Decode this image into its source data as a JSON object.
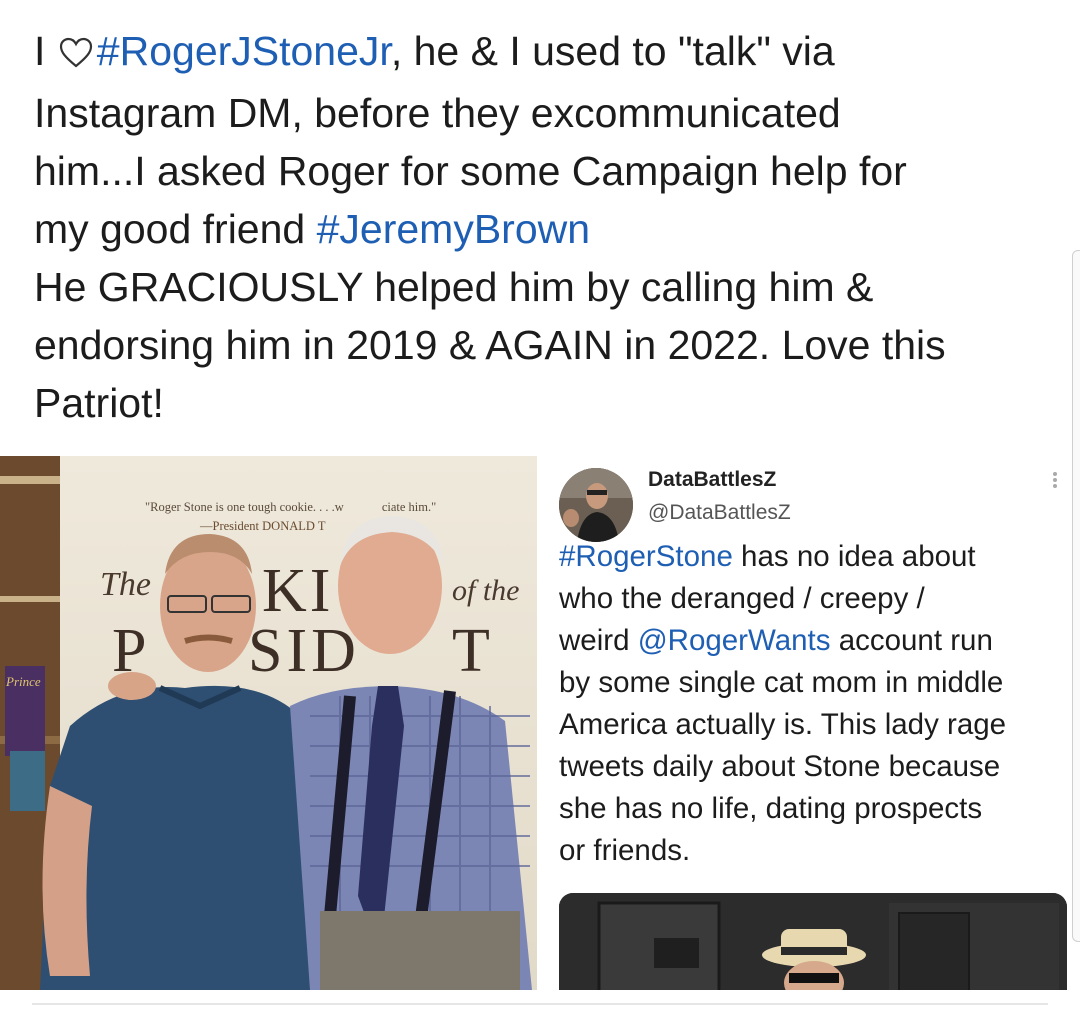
{
  "post": {
    "lines": [
      {
        "pre": "I ",
        "tag": "#RogerJStoneJr",
        "post": ", he & I used to \"talk\" via"
      },
      {
        "pre": "Instagram DM, before they excommunicated",
        "tag": "",
        "post": ""
      },
      {
        "pre": "him...I asked Roger for some Campaign help for",
        "tag": "",
        "post": ""
      },
      {
        "pre": "my good friend ",
        "tag": "#JeremyBrown",
        "post": ""
      },
      {
        "pre": "He GRACIOUSLY helped him by calling him &",
        "tag": "",
        "post": ""
      },
      {
        "pre": "endorsing him in 2019 & AGAIN in 2022. Love this",
        "tag": "",
        "post": ""
      },
      {
        "pre": "Patriot!",
        "tag": "",
        "post": ""
      }
    ]
  },
  "photo": {
    "quote_line1": "\"Roger Stone is one tough cookie. . . .w",
    "quote_line1b": "ciate him.\"",
    "quote_line2": "—President DONALD T",
    "book_the": "The",
    "book_ki": "KI",
    "book_of_the": "of the",
    "book_p": "P",
    "book_sid": "SID",
    "book_t": "T",
    "prince": "Prince"
  },
  "tweet": {
    "author_name": "DataBattlesZ",
    "author_handle": "@DataBattlesZ",
    "body": [
      {
        "tag": "#RogerStone",
        "text": " has no idea about"
      },
      {
        "tag": "",
        "text": "who the deranged / creepy /"
      },
      {
        "pre": "weird ",
        "tag": "@RogerWants",
        "text": " account run"
      },
      {
        "tag": "",
        "text": "by some single cat mom in middle"
      },
      {
        "tag": "",
        "text": "America actually is. This lady rage"
      },
      {
        "tag": "",
        "text": "tweets daily about Stone because"
      },
      {
        "tag": "",
        "text": "she has no life, dating prospects"
      },
      {
        "tag": "",
        "text": "or friends."
      }
    ]
  },
  "colors": {
    "hashtag": "#1e5fb4",
    "text": "#1c1c1c"
  },
  "icons": {
    "heart": "heart-outline-icon",
    "menu": "more-vertical-icon"
  }
}
